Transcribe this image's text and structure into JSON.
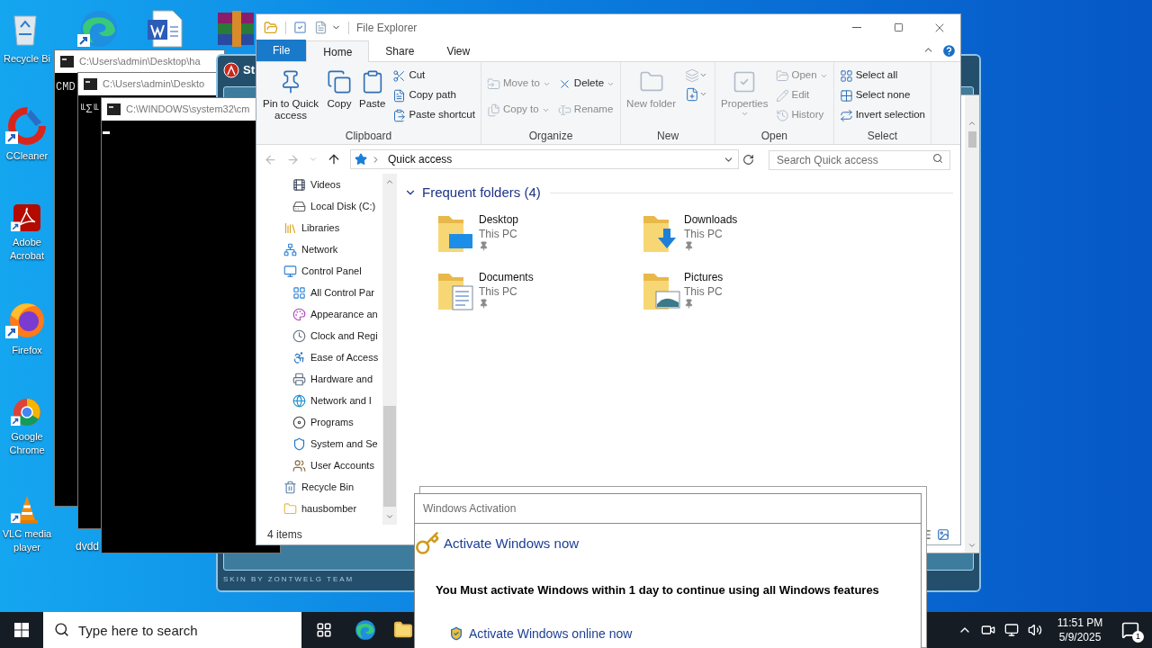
{
  "desktop": {
    "icons": [
      {
        "label": "Recycle Bi"
      },
      {
        "label": "CCleaner"
      },
      {
        "label": "Adobe Acrobat"
      },
      {
        "label": "Firefox"
      },
      {
        "label": "Google Chrome"
      },
      {
        "label": "VLC media player"
      }
    ],
    "partial_icon_label": "dvdd"
  },
  "console_windows": [
    {
      "title": "C:\\Users\\admin\\Desktop\\ha",
      "output": "CMD",
      "cursor": false
    },
    {
      "title": "C:\\Users\\admin\\Deskto",
      "output": "╙Σ╙",
      "cursor": false
    },
    {
      "title": "C:\\WINDOWS\\system32\\cm",
      "cursor": true
    }
  ],
  "skinned_window": {
    "title": "St",
    "footer": "SKIN BY ZONTWELG TEAM"
  },
  "file_explorer": {
    "title": "File Explorer",
    "tabs": [
      {
        "label": "File",
        "kind": "file",
        "selected": false
      },
      {
        "label": "Home",
        "kind": "tab",
        "selected": true
      },
      {
        "label": "Share",
        "kind": "tab",
        "selected": false
      },
      {
        "label": "View",
        "kind": "tab",
        "selected": false
      }
    ],
    "ribbon": [
      {
        "label": "Clipboard",
        "buttons": [
          {
            "label": "Pin to Quick access",
            "kind": "large",
            "disabled": false,
            "dropdown": false
          },
          {
            "label": "Copy",
            "kind": "large",
            "disabled": false,
            "dropdown": false
          },
          {
            "label": "Paste",
            "kind": "large",
            "disabled": false,
            "dropdown": false
          },
          {
            "label": "Cut",
            "kind": "small",
            "disabled": false,
            "dropdown": false
          },
          {
            "label": "Copy path",
            "kind": "small",
            "disabled": false,
            "dropdown": false
          },
          {
            "label": "Paste shortcut",
            "kind": "small",
            "disabled": false,
            "dropdown": false
          }
        ]
      },
      {
        "label": "Organize",
        "buttons": [
          {
            "label": "Move to",
            "kind": "small",
            "disabled": true,
            "dropdown": true
          },
          {
            "label": "Copy to",
            "kind": "small",
            "disabled": true,
            "dropdown": true
          },
          {
            "label": "Delete",
            "kind": "small",
            "disabled": false,
            "dropdown": true
          },
          {
            "label": "Rename",
            "kind": "small",
            "disabled": true,
            "dropdown": false
          }
        ]
      },
      {
        "label": "New",
        "buttons": [
          {
            "label": "New folder",
            "kind": "large",
            "disabled": true,
            "dropdown": false
          },
          {
            "kind": "icon",
            "disabled": true,
            "dropdown": true
          },
          {
            "kind": "icon",
            "disabled": false,
            "dropdown": true
          }
        ]
      },
      {
        "label": "Open",
        "buttons": [
          {
            "label": "Properties",
            "kind": "large",
            "disabled": true,
            "dropdown": true
          },
          {
            "label": "Open",
            "kind": "small",
            "disabled": true,
            "dropdown": true
          },
          {
            "label": "Edit",
            "kind": "small",
            "disabled": true,
            "dropdown": false
          },
          {
            "label": "History",
            "kind": "small",
            "disabled": true,
            "dropdown": false
          }
        ]
      },
      {
        "label": "Select",
        "buttons": [
          {
            "label": "Select all",
            "kind": "small",
            "disabled": false,
            "dropdown": false
          },
          {
            "label": "Select none",
            "kind": "small",
            "disabled": false,
            "dropdown": false
          },
          {
            "label": "Invert selection",
            "kind": "small",
            "disabled": false,
            "dropdown": false
          }
        ]
      }
    ],
    "address": {
      "location": "Quick access",
      "search_placeholder": "Search Quick access"
    },
    "navigation_pane": {
      "branch_items": [
        {
          "label": "Videos"
        },
        {
          "label": "Local Disk (C:)"
        }
      ],
      "items": [
        {
          "label": "Libraries"
        },
        {
          "label": "Network"
        },
        {
          "label": "Control Panel",
          "children": [
            {
              "label": "All Control Par"
            },
            {
              "label": "Appearance an"
            },
            {
              "label": "Clock and Regi"
            },
            {
              "label": "Ease of Access"
            },
            {
              "label": "Hardware and"
            },
            {
              "label": "Network and I"
            },
            {
              "label": "Programs"
            },
            {
              "label": "System and Se"
            },
            {
              "label": "User Accounts"
            }
          ]
        },
        {
          "label": "Recycle Bin"
        },
        {
          "label": "hausbomber"
        }
      ]
    },
    "section": {
      "title": "Frequent folders (4)",
      "expanded": true,
      "folders": [
        {
          "name": "Desktop",
          "location": "This PC",
          "pinned": true
        },
        {
          "name": "Downloads",
          "location": "This PC",
          "pinned": true
        },
        {
          "name": "Documents",
          "location": "This PC",
          "pinned": true
        },
        {
          "name": "Pictures",
          "location": "This PC",
          "pinned": true
        }
      ]
    },
    "status": "4 items"
  },
  "activation_dialog": {
    "title": "Windows Activation",
    "heading": "Activate Windows now",
    "message": "You Must activate Windows within 1 day to continue using all Windows features",
    "action": "Activate Windows online now"
  },
  "taskbar": {
    "search": {
      "placeholder": "Type here to search"
    },
    "clock": {
      "time": "11:51 PM",
      "date": "5/9/2025"
    },
    "notification_count": "1"
  }
}
